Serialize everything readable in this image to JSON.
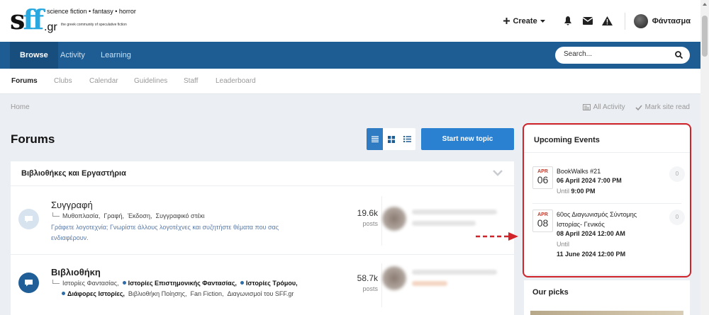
{
  "logo": {
    "brand": "sff",
    "domain": ".gr",
    "tagline": "science fiction • fantasy • horror",
    "subline": "the greek community of speculative fiction"
  },
  "userbar": {
    "create_label": "Create",
    "username": "Φάντασμα"
  },
  "nav": {
    "tabs": [
      "Browse",
      "Activity",
      "Learning"
    ],
    "search_placeholder": "Search..."
  },
  "subnav": {
    "tabs": [
      "Forums",
      "Clubs",
      "Calendar",
      "Guidelines",
      "Staff",
      "Leaderboard"
    ]
  },
  "breadcrumb": {
    "home": "Home",
    "all_activity": "All Activity",
    "mark_read": "Mark site read"
  },
  "page": {
    "title": "Forums",
    "start_topic": "Start new topic"
  },
  "category": {
    "title": "Βιβλιοθήκες και Εργαστήρια"
  },
  "forums": [
    {
      "name": "Συγγραφή",
      "subforums": [
        "Μυθοπλασία,",
        "Γραφή,",
        "Έκδοση,",
        "Συγγραφικό στέκι"
      ],
      "description_1": "Γράφετε λογοτεχνία; Γνωρίστε άλλους λογοτέχνες και συζητήστε θέματα που σας",
      "description_2": "ενδιαφέρουν.",
      "count": "19.6k",
      "count_label": "posts"
    },
    {
      "name": "Βιβλιοθήκη",
      "subforums_line1": [
        "Ιστορίες Φαντασίας,",
        "Ιστορίες Επιστημονικής Φαντασίας,",
        "Ιστορίες Τρόμου,"
      ],
      "subforums_line2": [
        "Διάφορες Ιστορίες,",
        "Βιβλιοθήκη Ποίησης,",
        "Fan Fiction,",
        "Διαγωνισμοί του SFF.gr"
      ],
      "count": "58.7k",
      "count_label": "posts"
    }
  ],
  "sidebar": {
    "events_title": "Upcoming Events",
    "events": [
      {
        "month": "APR",
        "day": "06",
        "title": "BookWalks #21",
        "date": "06 April 2024 7:00 PM",
        "until_label": "Until",
        "until": "9:00 PM",
        "count": "0"
      },
      {
        "month": "APR",
        "day": "08",
        "title_1": "60ος Διαγωνισμός Σύντομης",
        "title_2": "Ιστορίας- Γενικός",
        "date": "08 April 2024 12:00 AM",
        "until_label": "Until",
        "until": "11 June 2024 12:00 PM",
        "count": "0"
      }
    ],
    "picks_title": "Our picks"
  },
  "colors": {
    "nav": "#1d5d94",
    "accent": "#2b81d1",
    "highlight": "#d0232a"
  }
}
